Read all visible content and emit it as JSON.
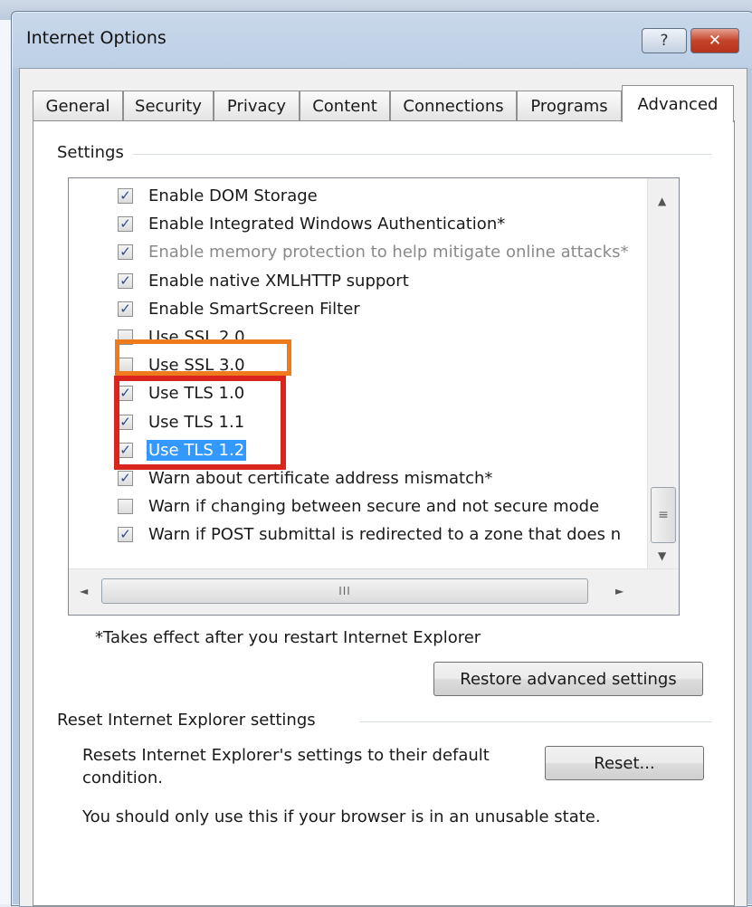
{
  "window": {
    "title": "Internet Options",
    "help_symbol": "?",
    "close_symbol": "✕"
  },
  "tabs": [
    {
      "label": "General"
    },
    {
      "label": "Security"
    },
    {
      "label": "Privacy"
    },
    {
      "label": "Content"
    },
    {
      "label": "Connections"
    },
    {
      "label": "Programs"
    },
    {
      "label": "Advanced",
      "active": true
    }
  ],
  "settings": {
    "group_label": "Settings",
    "options": [
      {
        "label": "Enable DOM Storage",
        "checked": true
      },
      {
        "label": "Enable Integrated Windows Authentication*",
        "checked": true
      },
      {
        "label": "Enable memory protection to help mitigate online attacks*",
        "checked": true,
        "disabled": true
      },
      {
        "label": "Enable native XMLHTTP support",
        "checked": true
      },
      {
        "label": "Enable SmartScreen Filter",
        "checked": true
      },
      {
        "label": "Use SSL 2.0",
        "checked": false
      },
      {
        "label": "Use SSL 3.0",
        "checked": false
      },
      {
        "label": "Use TLS 1.0",
        "checked": true
      },
      {
        "label": "Use TLS 1.1",
        "checked": true
      },
      {
        "label": "Use TLS 1.2",
        "checked": true,
        "selected": true
      },
      {
        "label": "Warn about certificate address mismatch*",
        "checked": true
      },
      {
        "label": "Warn if changing between secure and not secure mode",
        "checked": false
      },
      {
        "label": "Warn if POST submittal is redirected to a zone that does n",
        "checked": true
      }
    ],
    "restart_note": "*Takes effect after you restart Internet Explorer",
    "restore_button": "Restore advanced settings",
    "hscroll_grip": "III",
    "vscroll_grip": "≡"
  },
  "reset_section": {
    "group_label": "Reset Internet Explorer settings",
    "description_line1": "Resets Internet Explorer's settings to their default",
    "description_line2": "condition.",
    "reset_button": "Reset...",
    "warning": "You should only use this if your browser is in an unusable state."
  },
  "colors": {
    "ssl_highlight": "#f07b1c",
    "tls_highlight": "#d8261f",
    "selection": "#3399ff"
  },
  "icons": {
    "check": "✓",
    "scroll_up": "▲",
    "scroll_down": "▼",
    "scroll_left": "◄",
    "scroll_right": "►"
  }
}
